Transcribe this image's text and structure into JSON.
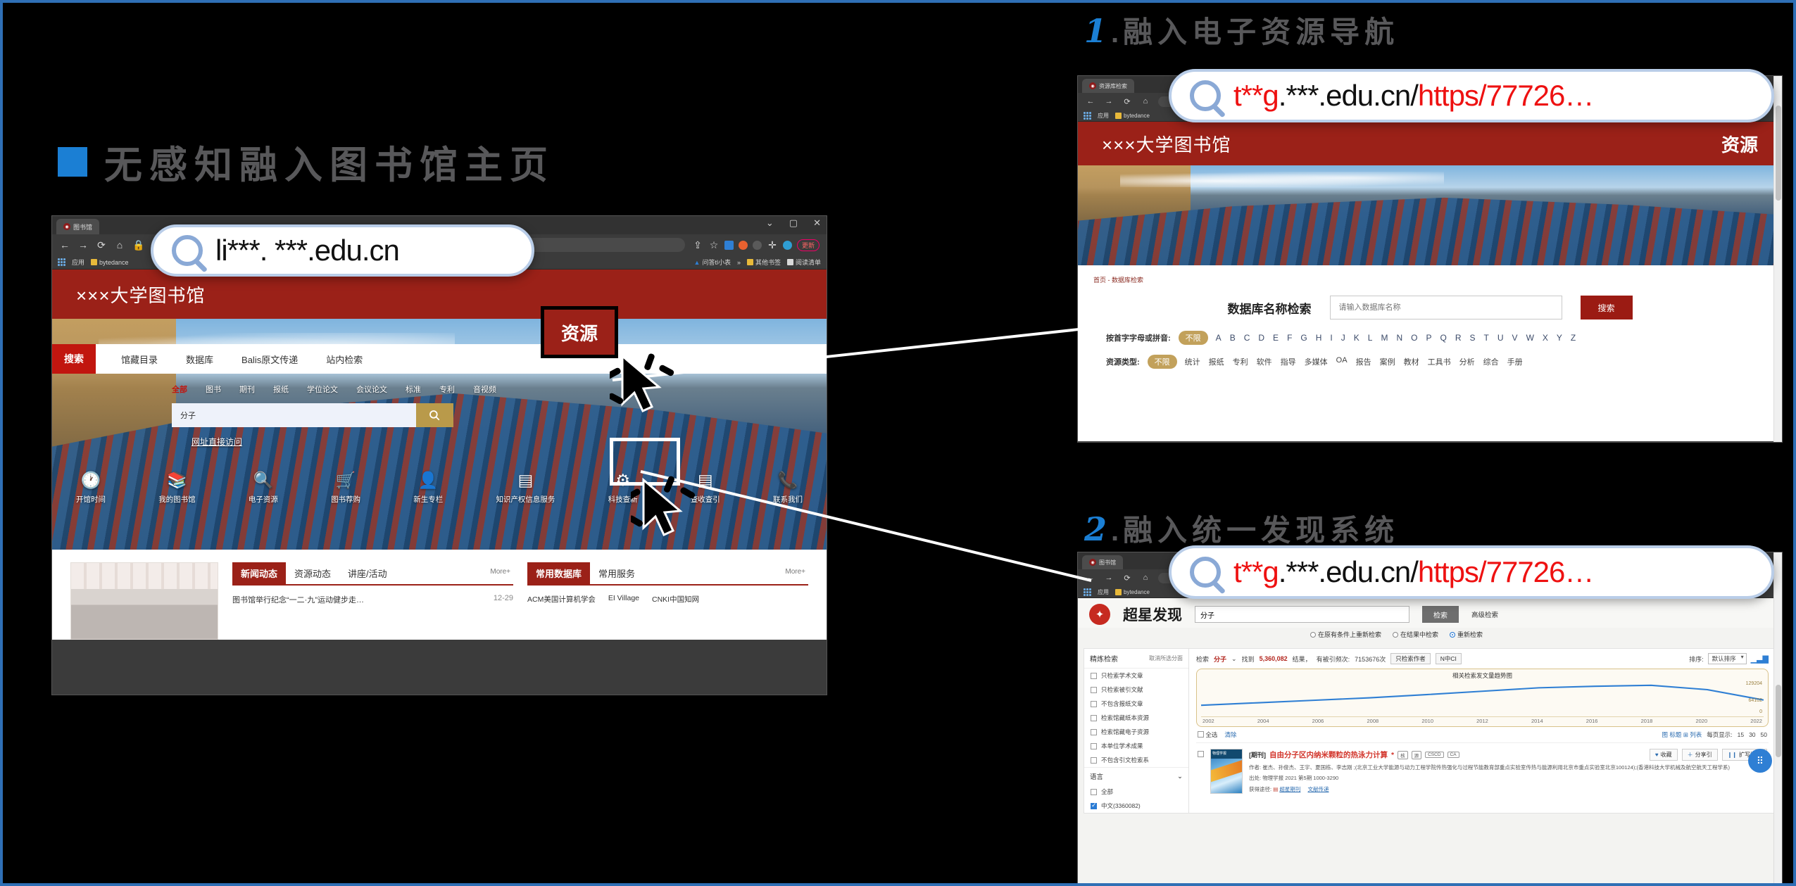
{
  "sections": {
    "main": {
      "heading": "无感知融入图书馆主页"
    },
    "panel1": {
      "num": "1",
      "dot": ".",
      "heading": "融入电子资源导航"
    },
    "panel2": {
      "num": "2",
      "dot": ".",
      "heading": "融入统一发现系统"
    }
  },
  "url_pills": {
    "main": {
      "plain": "li***. ***.edu.cn",
      "red_prefix": "",
      "red_suffix": ""
    },
    "panel1": {
      "prefix_red": "t**g",
      "middle": ".***.edu.cn/",
      "suffix_red": "https/77726…"
    },
    "panel2": {
      "prefix_red": "t**g",
      "middle": ".***.edu.cn/",
      "suffix_red": "https/77726…"
    }
  },
  "browser_main": {
    "tab_title": "图书馆",
    "bookmarks": [
      "应用",
      "bytedance",
      "问答tl小表",
      "其他书签",
      "阅读清单"
    ],
    "window_buttons": [
      "⌄",
      "▢",
      "✕"
    ],
    "update_pill": "更新"
  },
  "browser_p1": {
    "tab_title": "资源库检索",
    "bookmarks": [
      "应用",
      "bytedance"
    ]
  },
  "browser_p2": {
    "tab_title": "图书馆",
    "bookmarks": [
      "应用",
      "bytedance"
    ]
  },
  "library": {
    "site_title": "×××大学图书馆",
    "header_right": "资源",
    "callout_label": "资源",
    "nav_search_btn": "搜索",
    "nav_items": [
      "馆藏目录",
      "数据库",
      "Balis原文传递",
      "站内检索"
    ],
    "subnav": [
      "全部",
      "图书",
      "期刊",
      "报纸",
      "学位论文",
      "会议论文",
      "标准",
      "专利",
      "音视频"
    ],
    "subnav_active": "全部",
    "search_value": "分子",
    "search_placeholder": "",
    "search_icon": "search-icon",
    "direct_link": "网址直接访问",
    "service_icons": [
      {
        "icon": "clock-icon",
        "label": "开馆时间"
      },
      {
        "icon": "books-icon",
        "label": "我的图书馆"
      },
      {
        "icon": "search-circle-icon",
        "label": "电子资源"
      },
      {
        "icon": "cart-icon",
        "label": "图书荐购"
      },
      {
        "icon": "person-icon",
        "label": "新生专栏"
      },
      {
        "icon": "layers-icon",
        "label": "知识产权信息服务"
      },
      {
        "icon": "gear-icon",
        "label": "科技查新"
      },
      {
        "icon": "document-icon",
        "label": "查收查引"
      },
      {
        "icon": "phone-icon",
        "label": "联系我们"
      }
    ],
    "news": {
      "tabs": [
        "新闻动态",
        "资源动态",
        "讲座/活动"
      ],
      "active_tab": "新闻动态",
      "more": "More+",
      "item_title": "图书馆举行纪念“一二·九”运动健步走…",
      "item_date": "12-29"
    },
    "databases": {
      "tabs": [
        "常用数据库",
        "常用服务"
      ],
      "active_tab": "常用数据库",
      "more": "More+",
      "links": [
        "ACM美国计算机学会",
        "EI Village",
        "CNKI中国知网"
      ]
    }
  },
  "panel1_page": {
    "site_title": "×××大学图书馆",
    "header_right": "资源",
    "breadcrumb": "首页 - 数据库检索",
    "search_label": "数据库名称检索",
    "search_placeholder": "请输入数据库名称",
    "search_button": "搜索",
    "alpha_label": "按首字字母或拼音:",
    "alpha_all": "不限",
    "letters": [
      "A",
      "B",
      "C",
      "D",
      "E",
      "F",
      "G",
      "H",
      "I",
      "J",
      "K",
      "L",
      "M",
      "N",
      "O",
      "P",
      "Q",
      "R",
      "S",
      "T",
      "U",
      "V",
      "W",
      "X",
      "Y",
      "Z"
    ],
    "type_label": "资源类型:",
    "type_all": "不限",
    "types": [
      "统计",
      "报纸",
      "专利",
      "软件",
      "指导",
      "多媒体",
      "OA",
      "报告",
      "案例",
      "教材",
      "工具书",
      "分析",
      "综合",
      "手册"
    ]
  },
  "panel2_page": {
    "brand": "超星发现",
    "search_value": "分子",
    "search_button": "检索",
    "advanced": "高级检索",
    "radios": [
      {
        "label": "在原有条件上重新检索",
        "checked": false
      },
      {
        "label": "在结果中检索",
        "checked": false
      },
      {
        "label": "重新检索",
        "checked": true
      }
    ],
    "sidebar": {
      "title": "精炼检索",
      "clear": "取消所选分面",
      "items": [
        {
          "label": "只检索学术文章",
          "checked": false
        },
        {
          "label": "只检索被引文献",
          "checked": false
        },
        {
          "label": "不包含报纸文章",
          "checked": false
        },
        {
          "label": "检索馆藏纸本资源",
          "checked": false
        },
        {
          "label": "检索馆藏电子资源",
          "checked": false
        },
        {
          "label": "本单位学术成果",
          "checked": false
        },
        {
          "label": "不包含引文检索系",
          "checked": false
        }
      ],
      "sections": [
        {
          "label": "语言",
          "expand": "⌄"
        }
      ],
      "language": [
        {
          "label": "全部",
          "checked": false
        },
        {
          "label": "中文(3360082)",
          "checked": true
        }
      ]
    },
    "results_meta": {
      "prefix": "检索",
      "keyword": "分子",
      "found_label": "找到",
      "count": "5,360,082",
      "count_unit": "结果，",
      "downloads_label": "有被引频次:",
      "downloads": "7153676次",
      "btn_author": "只检索作者",
      "btn_export": "N中CI"
    },
    "sort": {
      "label": "排序:",
      "value": "默认排序"
    },
    "list_controls": {
      "select_all": "全选",
      "clear": "清除"
    },
    "pager": {
      "label": "每页显示:",
      "options": [
        "15",
        "30",
        "50"
      ],
      "display_mode": "图 标题 ⊞ 列表"
    },
    "result": {
      "kind": "[期刊]",
      "title": "自由分子区内纳米颗粒的热泳力计算",
      "star": "*",
      "badges": [
        "核",
        "源",
        "CSCD",
        "CA"
      ],
      "authors_label": "作者:",
      "authors": "崔杰、孙俊杰、王宇、夏国栋、李志刚 ;(北京工业大学能源与动力工程学院传热强化与过程节能教育部重点实验室传热与能源利用北京市重点实验室北京100124);(香港科技大学机械及航空航天工程学系)",
      "source_label": "出处:",
      "source": "物理学报 2021 第5期 1000-3290",
      "access_label": "获得途径:",
      "access_links": [
        "超星期刊",
        "文献传递"
      ],
      "actions": [
        "收藏",
        "分享引",
        "扩写阅读"
      ]
    },
    "chart_data": {
      "type": "line",
      "title": "相关检索发文量趋势图",
      "x": [
        2002,
        2004,
        2006,
        2008,
        2010,
        2012,
        2014,
        2016,
        2018,
        2020,
        2022
      ],
      "values": [
        41000,
        52000,
        63000,
        74000,
        88000,
        103000,
        118000,
        125000,
        129204,
        110000,
        64102
      ],
      "ylabels": [
        "129204",
        "64102",
        "0"
      ],
      "ylim": [
        0,
        129204
      ],
      "xlabel": "",
      "ylabel": "",
      "grid": false,
      "legend": "none"
    }
  }
}
